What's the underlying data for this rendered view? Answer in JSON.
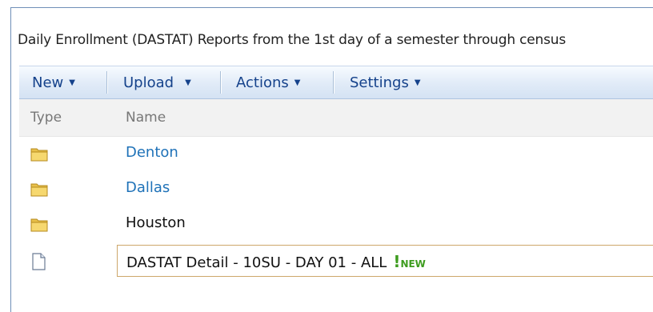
{
  "list": {
    "description": "Daily Enrollment (DASTAT) Reports from the 1st day of a semester through census"
  },
  "toolbar": {
    "new_label": "New",
    "upload_label": "Upload",
    "actions_label": "Actions",
    "settings_label": "Settings"
  },
  "columns": {
    "type": "Type",
    "name": "Name"
  },
  "items": [
    {
      "name": "Denton",
      "icon": "folder-icon"
    },
    {
      "name": "Dallas",
      "icon": "folder-icon"
    },
    {
      "name": "Houston",
      "icon": "folder-icon"
    },
    {
      "name": "DASTAT Detail - 10SU - DAY 01 - ALL",
      "icon": "document-icon",
      "badge_mark": "!",
      "badge_text": "NEW"
    }
  ],
  "colors": {
    "toolbar_text": "#15428b",
    "link": "#1f72b8",
    "new_badge": "#3d9c1e",
    "selection_border": "#cda76a"
  }
}
